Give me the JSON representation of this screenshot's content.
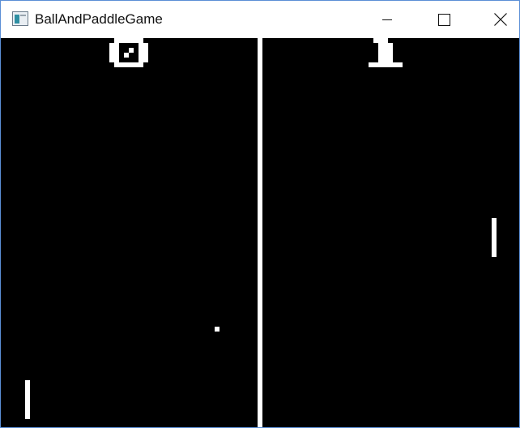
{
  "window": {
    "title": "BallAndPaddleGame",
    "controls": {
      "minimize_icon": "minimize-icon",
      "maximize_icon": "maximize-icon",
      "close_icon": "close-icon"
    }
  },
  "game": {
    "background": "#000000",
    "foreground": "#ffffff",
    "score": {
      "left": "0",
      "right": "1"
    }
  }
}
